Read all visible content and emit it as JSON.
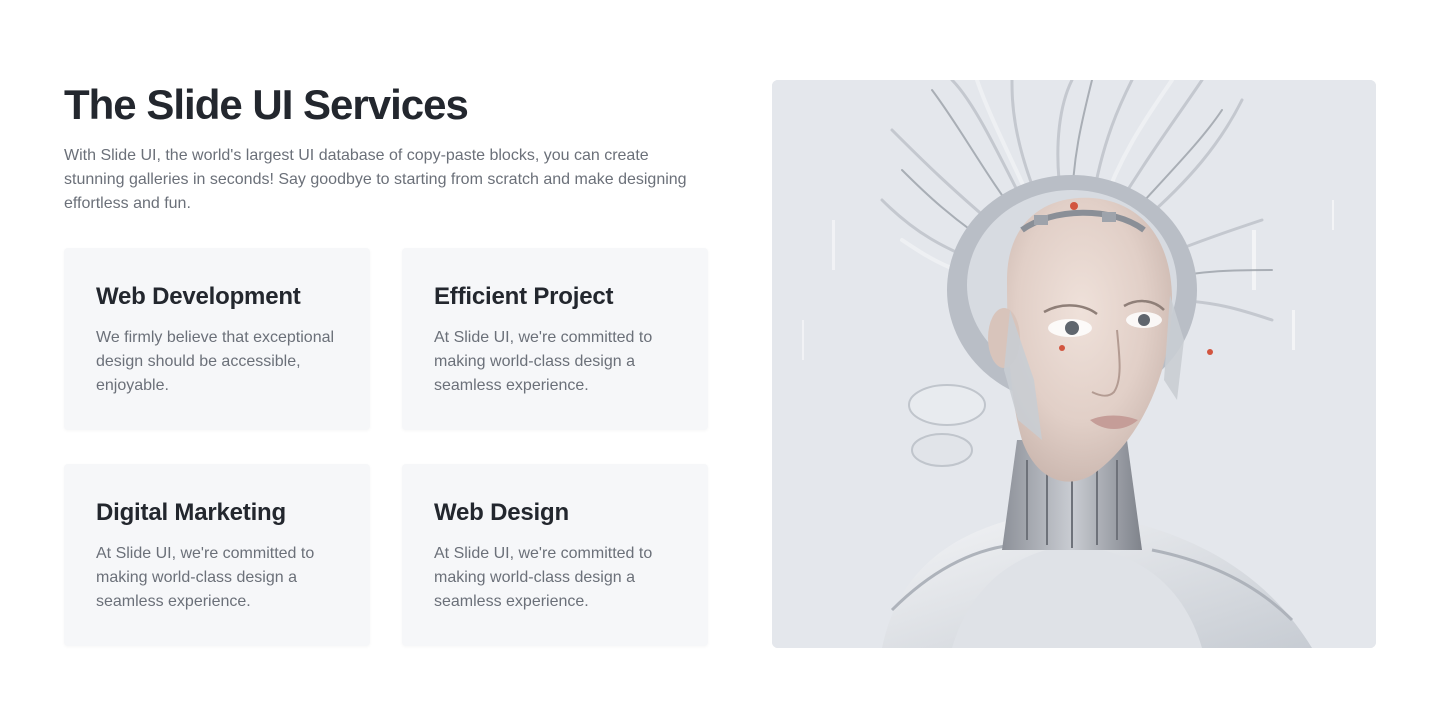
{
  "services": {
    "title": "The Slide UI Services",
    "intro": "With Slide UI, the world's largest UI database of copy-paste blocks, you can create stunning galleries in seconds! Say goodbye to starting from scratch and make designing effortless and fun.",
    "cards": [
      {
        "title": "Web Development",
        "text": "We firmly believe that exceptional design should be accessible, enjoyable."
      },
      {
        "title": "Efficient Project",
        "text": "At Slide UI, we're committed to making world-class design a seamless experience."
      },
      {
        "title": "Digital Marketing",
        "text": "At Slide UI, we're committed to making world-class design a seamless experience."
      },
      {
        "title": "Web Design",
        "text": "At Slide UI, we're committed to making world-class design a seamless experience."
      }
    ]
  },
  "hero_image": {
    "description_icon": "robot-woman-illustration"
  }
}
